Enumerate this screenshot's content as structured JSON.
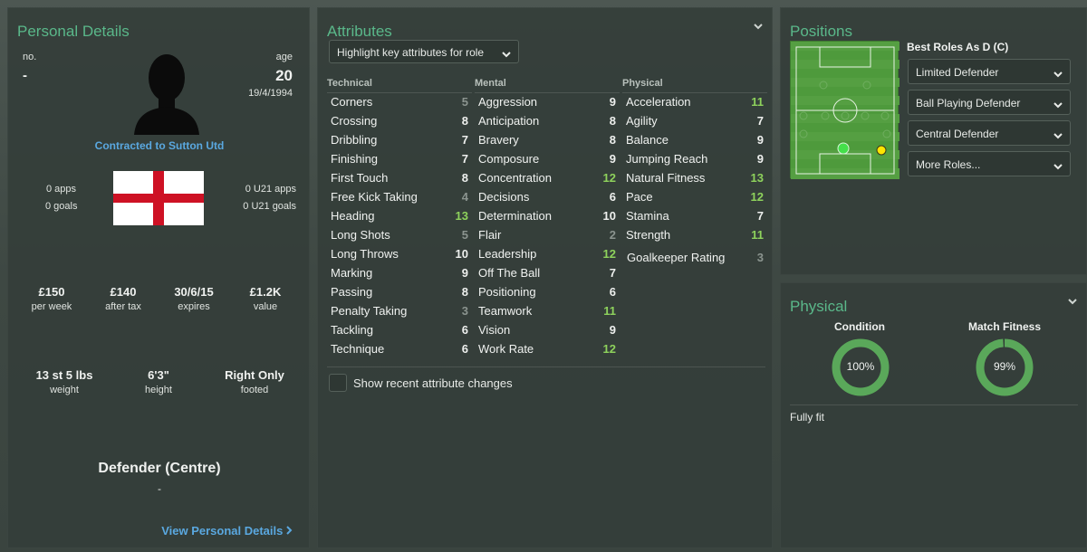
{
  "personal": {
    "title": "Personal Details",
    "no_label": "no.",
    "no_value": "-",
    "age_label": "age",
    "age_value": "20",
    "dob": "19/4/1994",
    "contracted": "Contracted to Sutton Utd",
    "apps": "0 apps",
    "goals": "0 goals",
    "u21_apps": "0 U21 apps",
    "u21_goals": "0 U21 goals",
    "flag_icon": "england-flag-icon",
    "wages": [
      {
        "value": "£150",
        "label": "per week"
      },
      {
        "value": "£140",
        "label": "after tax"
      },
      {
        "value": "30/6/15",
        "label": "expires"
      },
      {
        "value": "£1.2K",
        "label": "value"
      }
    ],
    "body": [
      {
        "value": "13 st 5 lbs",
        "label": "weight"
      },
      {
        "value": "6'3\"",
        "label": "height"
      },
      {
        "value": "Right Only",
        "label": "footed"
      }
    ],
    "position": "Defender (Centre)",
    "position_sub": "-",
    "view_link": "View Personal Details"
  },
  "attributes": {
    "title": "Attributes",
    "highlight_dropdown": "Highlight key attributes for role",
    "technical_head": "Technical",
    "mental_head": "Mental",
    "physical_head": "Physical",
    "technical": [
      {
        "name": "Corners",
        "value": "5",
        "tone": "grey"
      },
      {
        "name": "Crossing",
        "value": "8",
        "tone": "white"
      },
      {
        "name": "Dribbling",
        "value": "7",
        "tone": "white"
      },
      {
        "name": "Finishing",
        "value": "7",
        "tone": "white"
      },
      {
        "name": "First Touch",
        "value": "8",
        "tone": "white"
      },
      {
        "name": "Free Kick Taking",
        "value": "4",
        "tone": "grey"
      },
      {
        "name": "Heading",
        "value": "13",
        "tone": "green"
      },
      {
        "name": "Long Shots",
        "value": "5",
        "tone": "grey"
      },
      {
        "name": "Long Throws",
        "value": "10",
        "tone": "white"
      },
      {
        "name": "Marking",
        "value": "9",
        "tone": "white"
      },
      {
        "name": "Passing",
        "value": "8",
        "tone": "white"
      },
      {
        "name": "Penalty Taking",
        "value": "3",
        "tone": "grey"
      },
      {
        "name": "Tackling",
        "value": "6",
        "tone": "white"
      },
      {
        "name": "Technique",
        "value": "6",
        "tone": "white"
      }
    ],
    "mental": [
      {
        "name": "Aggression",
        "value": "9",
        "tone": "white"
      },
      {
        "name": "Anticipation",
        "value": "8",
        "tone": "white"
      },
      {
        "name": "Bravery",
        "value": "8",
        "tone": "white"
      },
      {
        "name": "Composure",
        "value": "9",
        "tone": "white"
      },
      {
        "name": "Concentration",
        "value": "12",
        "tone": "green"
      },
      {
        "name": "Decisions",
        "value": "6",
        "tone": "white"
      },
      {
        "name": "Determination",
        "value": "10",
        "tone": "white"
      },
      {
        "name": "Flair",
        "value": "2",
        "tone": "grey"
      },
      {
        "name": "Leadership",
        "value": "12",
        "tone": "green"
      },
      {
        "name": "Off The Ball",
        "value": "7",
        "tone": "white"
      },
      {
        "name": "Positioning",
        "value": "6",
        "tone": "white"
      },
      {
        "name": "Teamwork",
        "value": "11",
        "tone": "green"
      },
      {
        "name": "Vision",
        "value": "9",
        "tone": "white"
      },
      {
        "name": "Work Rate",
        "value": "12",
        "tone": "green"
      }
    ],
    "physical": [
      {
        "name": "Acceleration",
        "value": "11",
        "tone": "green"
      },
      {
        "name": "Agility",
        "value": "7",
        "tone": "white"
      },
      {
        "name": "Balance",
        "value": "9",
        "tone": "white"
      },
      {
        "name": "Jumping Reach",
        "value": "9",
        "tone": "white"
      },
      {
        "name": "Natural Fitness",
        "value": "13",
        "tone": "green"
      },
      {
        "name": "Pace",
        "value": "12",
        "tone": "green"
      },
      {
        "name": "Stamina",
        "value": "7",
        "tone": "white"
      },
      {
        "name": "Strength",
        "value": "11",
        "tone": "green"
      }
    ],
    "gk_rating_label": "Goalkeeper Rating",
    "gk_rating_value": "3",
    "recent_changes": "Show recent attribute changes"
  },
  "positions": {
    "title": "Positions",
    "best_roles": "Best Roles As D (C)",
    "roles": [
      "Limited Defender",
      "Ball Playing Defender",
      "Central Defender",
      "More Roles..."
    ]
  },
  "physical": {
    "title": "Physical",
    "condition_label": "Condition",
    "condition_value": "100%",
    "condition_fraction": 1.0,
    "fitness_label": "Match Fitness",
    "fitness_value": "99%",
    "fitness_fraction": 0.99,
    "status": "Fully fit"
  },
  "colors": {
    "accent": "#5ab88a",
    "link": "#5aa8e0",
    "good": "#8ed25c",
    "ring": "#5aa85a"
  }
}
